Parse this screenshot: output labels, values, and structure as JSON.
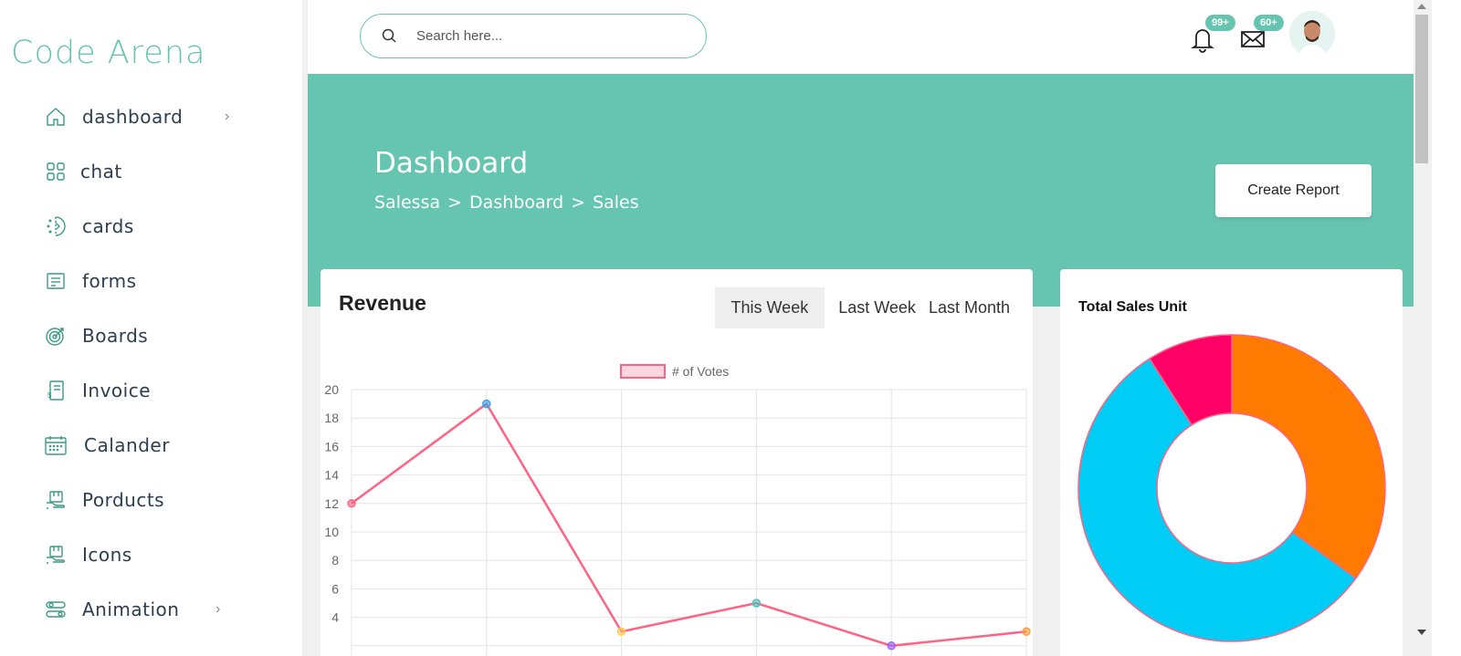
{
  "brand": "Code Arena",
  "sidebar": {
    "items": [
      {
        "label": "dashboard",
        "icon": "home-icon",
        "has_chevron": true
      },
      {
        "label": "chat",
        "icon": "grid-icon",
        "has_chevron": false
      },
      {
        "label": "cards",
        "icon": "half-circle-icon",
        "has_chevron": false
      },
      {
        "label": "forms",
        "icon": "document-icon",
        "has_chevron": false
      },
      {
        "label": "Boards",
        "icon": "target-icon",
        "has_chevron": false
      },
      {
        "label": "Invoice",
        "icon": "invoice-icon",
        "has_chevron": false
      },
      {
        "label": "Calander",
        "icon": "calendar-icon",
        "has_chevron": false
      },
      {
        "label": "Porducts",
        "icon": "box-icon",
        "has_chevron": false
      },
      {
        "label": "Icons",
        "icon": "box-icon",
        "has_chevron": false
      },
      {
        "label": "Animation",
        "icon": "toggle-icon",
        "has_chevron": true
      }
    ]
  },
  "topbar": {
    "search_placeholder": "Search here...",
    "notifications_badge": "99+",
    "messages_badge": "60+"
  },
  "hero": {
    "title": "Dashboard",
    "breadcrumb": [
      "Salessa",
      ">",
      "Dashboard",
      ">",
      "Sales"
    ],
    "create_report_label": "Create Report"
  },
  "revenue": {
    "title": "Revenue",
    "tabs": [
      "This Week",
      "Last Week",
      "Last Month"
    ],
    "active_tab": "This Week"
  },
  "sales": {
    "title": "Total Sales Unit"
  },
  "colors": {
    "accent": "#66c5b1",
    "line": "#ff6384",
    "pie_orange": "#ff7a00",
    "pie_blue": "#00cdf5",
    "pie_pink": "#ff0066"
  },
  "chart_data": [
    {
      "type": "line",
      "legend": [
        "# of Votes"
      ],
      "x": [
        0,
        1,
        2,
        3,
        4,
        5
      ],
      "series": [
        {
          "name": "# of Votes",
          "values": [
            12,
            19,
            3,
            5,
            2,
            3
          ]
        }
      ],
      "point_colors": [
        "#ff6384",
        "#36a2eb",
        "#ffce56",
        "#4bc0c0",
        "#9966ff",
        "#ff9f40"
      ],
      "yticks": [
        4,
        6,
        8,
        10,
        12,
        14,
        16,
        18,
        20
      ],
      "ylim": [
        2,
        20
      ],
      "grid": true
    },
    {
      "type": "pie",
      "variant": "donut",
      "slices": [
        {
          "color": "#ff7a00",
          "value": 35
        },
        {
          "color": "#00cdf5",
          "value": 56
        },
        {
          "color": "#ff0066",
          "value": 9
        }
      ]
    }
  ]
}
